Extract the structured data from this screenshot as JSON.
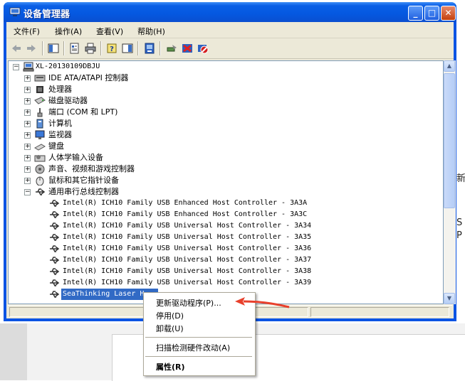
{
  "window": {
    "title": "设备管理器",
    "title_colors": {
      "active": "#0558e0",
      "close": "#c3400e"
    }
  },
  "title_buttons": {
    "minimize": "_",
    "maximize": "□",
    "close": "✕"
  },
  "menubar": {
    "items": [
      {
        "label": "文件(F)"
      },
      {
        "label": "操作(A)"
      },
      {
        "label": "查看(V)"
      },
      {
        "label": "帮助(H)"
      }
    ]
  },
  "toolbar": {
    "icons": [
      "back-arrow-icon",
      "forward-arrow-icon",
      "show-hide-tree-icon",
      "properties-icon",
      "print-icon",
      "help-icon",
      "show-hide-action-pane-icon",
      "update-driver-icon",
      "scan-hardware-icon",
      "uninstall-icon",
      "disable-icon"
    ]
  },
  "tree": {
    "root": {
      "label": "XL-20130109DBJU",
      "expander": "−"
    },
    "categories": [
      {
        "label": "IDE ATA/ATAPI 控制器",
        "expander": "+"
      },
      {
        "label": "处理器",
        "expander": "+"
      },
      {
        "label": "磁盘驱动器",
        "expander": "+"
      },
      {
        "label": "端口 (COM 和 LPT)",
        "expander": "+"
      },
      {
        "label": "计算机",
        "expander": "+"
      },
      {
        "label": "监视器",
        "expander": "+"
      },
      {
        "label": "键盘",
        "expander": "+"
      },
      {
        "label": "人体学输入设备",
        "expander": "+"
      },
      {
        "label": "声音、视频和游戏控制器",
        "expander": "+"
      },
      {
        "label": "鼠标和其它指针设备",
        "expander": "+"
      },
      {
        "label": "通用串行总线控制器",
        "expander": "−"
      }
    ],
    "usb_devices": [
      {
        "label": "Intel(R) ICH10 Family USB Enhanced Host Controller - 3A3A"
      },
      {
        "label": "Intel(R) ICH10 Family USB Enhanced Host Controller - 3A3C"
      },
      {
        "label": "Intel(R) ICH10 Family USB Universal Host Controller - 3A34"
      },
      {
        "label": "Intel(R) ICH10 Family USB Universal Host Controller - 3A35"
      },
      {
        "label": "Intel(R) ICH10 Family USB Universal Host Controller - 3A36"
      },
      {
        "label": "Intel(R) ICH10 Family USB Universal Host Controller - 3A37"
      },
      {
        "label": "Intel(R) ICH10 Family USB Universal Host Controller - 3A38"
      },
      {
        "label": "Intel(R) ICH10 Family USB Universal Host Controller - 3A39"
      }
    ],
    "selected_device": {
      "label": "SeaThinking Laser H..."
    }
  },
  "context_menu": {
    "update_driver": "更新驱动程序(P)...",
    "disable": "停用(D)",
    "uninstall": "卸载(U)",
    "scan": "扫描检测硬件改动(A)",
    "properties": "属性(R)"
  },
  "background": {
    "edge_chars": [
      "新",
      "S",
      "P"
    ]
  },
  "colors": {
    "selection": "#316ac5",
    "annotation_arrow": "#e8402c"
  }
}
